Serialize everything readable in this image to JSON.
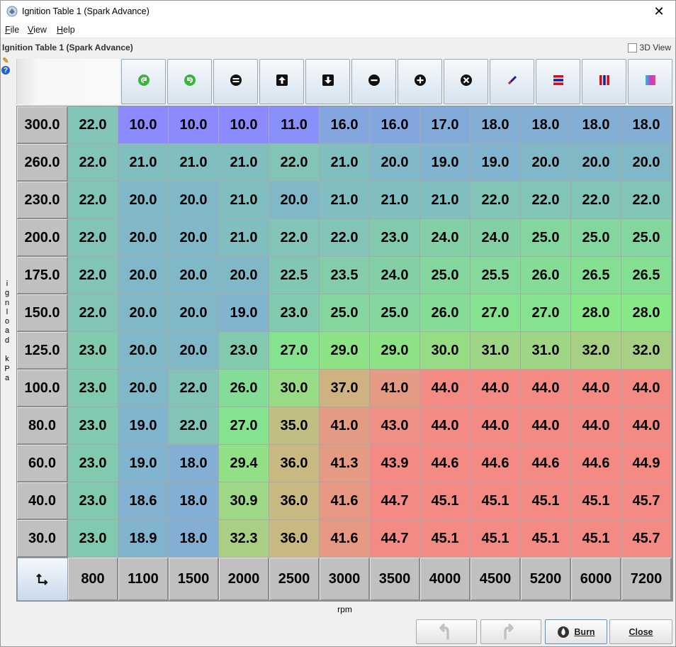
{
  "window": {
    "title": "Ignition Table 1 (Spark Advance)",
    "close_glyph": "✕"
  },
  "menu": [
    {
      "label": "File",
      "mnemonic": "F",
      "rest": "ile"
    },
    {
      "label": "View",
      "mnemonic": "V",
      "rest": "iew"
    },
    {
      "label": "Help",
      "mnemonic": "H",
      "rest": "elp"
    }
  ],
  "panel": {
    "title": "Ignition Table 1 (Spark Advance)",
    "view3d_label": "3D View",
    "view3d_checked": false
  },
  "toolbar": {
    "buttons": [
      {
        "name": "rotate-left-icon",
        "kind": "green-left",
        "color": "#3bb53b"
      },
      {
        "name": "rotate-right-icon",
        "kind": "green-right",
        "color": "#3bb53b"
      },
      {
        "name": "set-equal-icon",
        "kind": "equal",
        "color": "#111111"
      },
      {
        "name": "increment-icon",
        "kind": "up",
        "color": "#111111"
      },
      {
        "name": "decrement-icon",
        "kind": "down",
        "color": "#111111"
      },
      {
        "name": "subtract-icon",
        "kind": "minus",
        "color": "#111111"
      },
      {
        "name": "add-icon",
        "kind": "plus",
        "color": "#111111"
      },
      {
        "name": "multiply-icon",
        "kind": "times",
        "color": "#111111"
      },
      {
        "name": "interpolate-icon",
        "kind": "pen",
        "color": "#1a1aa0"
      },
      {
        "name": "interpolate-horizontal-icon",
        "kind": "hbars",
        "color": "#d01010"
      },
      {
        "name": "interpolate-vertical-icon",
        "kind": "vbars",
        "color": "#1a1aa0"
      },
      {
        "name": "smooth-icon",
        "kind": "gradient",
        "color": "#c040c0"
      }
    ]
  },
  "axes": {
    "y_label": "ignload kPa",
    "x_label": "rpm"
  },
  "table": {
    "y_values": [
      "300.0",
      "260.0",
      "230.0",
      "200.0",
      "175.0",
      "150.0",
      "125.0",
      "100.0",
      "80.0",
      "60.0",
      "40.0",
      "30.0"
    ],
    "x_values": [
      "800",
      "1100",
      "1500",
      "2000",
      "2500",
      "3000",
      "3500",
      "4000",
      "4500",
      "5200",
      "6000",
      "7200"
    ],
    "cells": [
      [
        "22.0",
        "10.0",
        "10.0",
        "10.0",
        "11.0",
        "16.0",
        "16.0",
        "17.0",
        "18.0",
        "18.0",
        "18.0",
        "18.0"
      ],
      [
        "22.0",
        "21.0",
        "21.0",
        "21.0",
        "22.0",
        "21.0",
        "20.0",
        "19.0",
        "19.0",
        "20.0",
        "20.0",
        "20.0"
      ],
      [
        "22.0",
        "20.0",
        "20.0",
        "21.0",
        "20.0",
        "21.0",
        "21.0",
        "21.0",
        "22.0",
        "22.0",
        "22.0",
        "22.0"
      ],
      [
        "22.0",
        "20.0",
        "20.0",
        "21.0",
        "22.0",
        "22.0",
        "23.0",
        "24.0",
        "24.0",
        "25.0",
        "25.0",
        "25.0"
      ],
      [
        "22.0",
        "20.0",
        "20.0",
        "20.0",
        "22.5",
        "23.5",
        "24.0",
        "25.0",
        "25.5",
        "26.0",
        "26.5",
        "26.5"
      ],
      [
        "22.0",
        "20.0",
        "20.0",
        "19.0",
        "23.0",
        "25.0",
        "25.0",
        "26.0",
        "27.0",
        "27.0",
        "28.0",
        "28.0"
      ],
      [
        "23.0",
        "20.0",
        "20.0",
        "23.0",
        "27.0",
        "29.0",
        "29.0",
        "30.0",
        "31.0",
        "31.0",
        "32.0",
        "32.0"
      ],
      [
        "23.0",
        "20.0",
        "22.0",
        "26.0",
        "30.0",
        "37.0",
        "41.0",
        "44.0",
        "44.0",
        "44.0",
        "44.0",
        "44.0"
      ],
      [
        "23.0",
        "19.0",
        "22.0",
        "27.0",
        "35.0",
        "41.0",
        "43.0",
        "44.0",
        "44.0",
        "44.0",
        "44.0",
        "44.0"
      ],
      [
        "23.0",
        "19.0",
        "18.0",
        "29.4",
        "36.0",
        "41.3",
        "43.9",
        "44.6",
        "44.6",
        "44.6",
        "44.6",
        "44.9"
      ],
      [
        "23.0",
        "18.6",
        "18.0",
        "30.9",
        "36.0",
        "41.6",
        "44.7",
        "45.1",
        "45.1",
        "45.1",
        "45.1",
        "45.7"
      ],
      [
        "23.0",
        "18.9",
        "18.0",
        "32.3",
        "36.0",
        "41.6",
        "44.7",
        "45.1",
        "45.1",
        "45.1",
        "45.1",
        "45.7"
      ]
    ],
    "color_scale": {
      "low": "#8b8bff",
      "mid_low": "#80b8c8",
      "mid": "#86e886",
      "mid_high": "#c8b882",
      "high": "#f48a84"
    }
  },
  "footer": {
    "undo_label": "",
    "redo_label": "",
    "burn_label": "Burn",
    "close_label": "Close"
  }
}
